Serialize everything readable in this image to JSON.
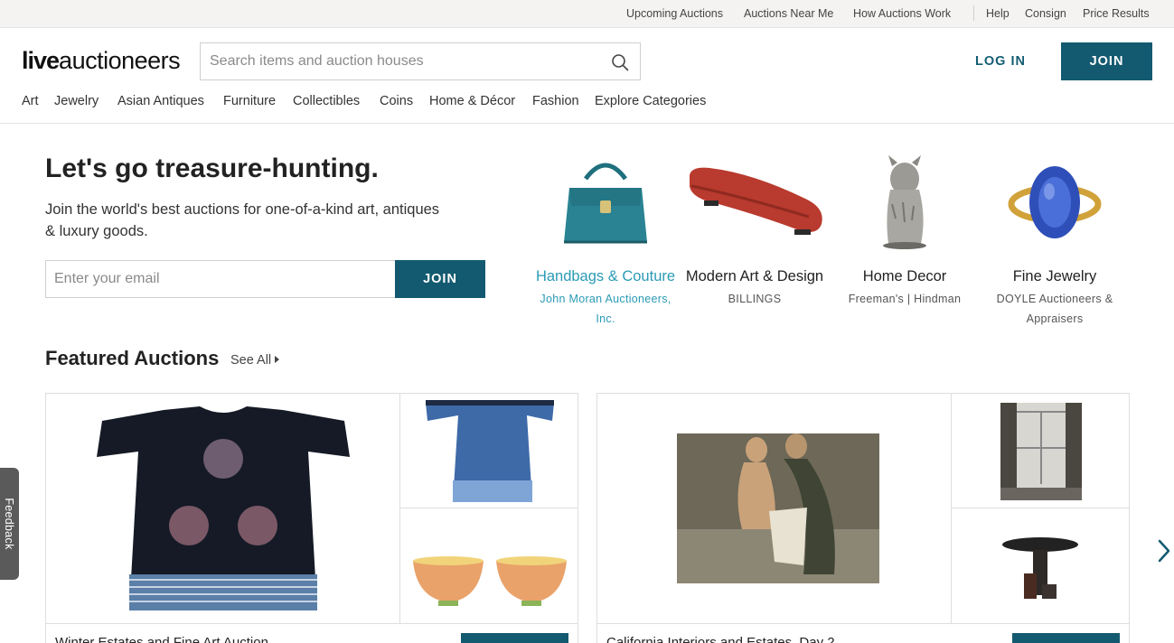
{
  "utility_nav": [
    {
      "label": "Upcoming Auctions"
    },
    {
      "label": "Auctions Near Me"
    },
    {
      "label": "How Auctions Work"
    },
    {
      "label": "Help"
    },
    {
      "label": "Consign"
    },
    {
      "label": "Price Results"
    }
  ],
  "header": {
    "logo_bold": "live",
    "logo_rest": "auctioneers",
    "search_placeholder": "Search items and auction houses",
    "search_icon": "search-icon",
    "login_label": "LOG IN",
    "join_label": "JOIN"
  },
  "categories": [
    {
      "label": "Art"
    },
    {
      "label": "Jewelry"
    },
    {
      "label": "Asian Antiques"
    },
    {
      "label": "Furniture"
    },
    {
      "label": "Collectibles"
    },
    {
      "label": "Coins"
    },
    {
      "label": "Home & Décor"
    },
    {
      "label": "Fashion"
    },
    {
      "label": "Explore Categories"
    }
  ],
  "hero": {
    "title": "Let's go treasure-hunting.",
    "subtitle": "Join the world's best auctions for one-of-a-kind art, antiques & luxury goods.",
    "email_placeholder": "Enter your email",
    "join_label": "JOIN"
  },
  "category_tiles": [
    {
      "name": "Handbags & Couture",
      "house": "John Moran Auctioneers, Inc.",
      "active": true
    },
    {
      "name": "Modern Art & Design",
      "house": "BILLINGS",
      "active": false
    },
    {
      "name": "Home Decor",
      "house": "Freeman's | Hindman",
      "active": false
    },
    {
      "name": "Fine Jewelry",
      "house": "DOYLE Auctioneers & Appraisers",
      "active": false
    }
  ],
  "featured": {
    "title": "Featured Auctions",
    "see_all": "See All",
    "auctions": [
      {
        "title": "Winter Estates and Fine Art Auction"
      },
      {
        "title": "California Interiors and Estates, Day 2"
      }
    ]
  },
  "feedback_label": "Feedback",
  "colors": {
    "brand_teal": "#135a70",
    "active_link": "#2a9bb5",
    "utility_bg": "#f4f3f1"
  }
}
